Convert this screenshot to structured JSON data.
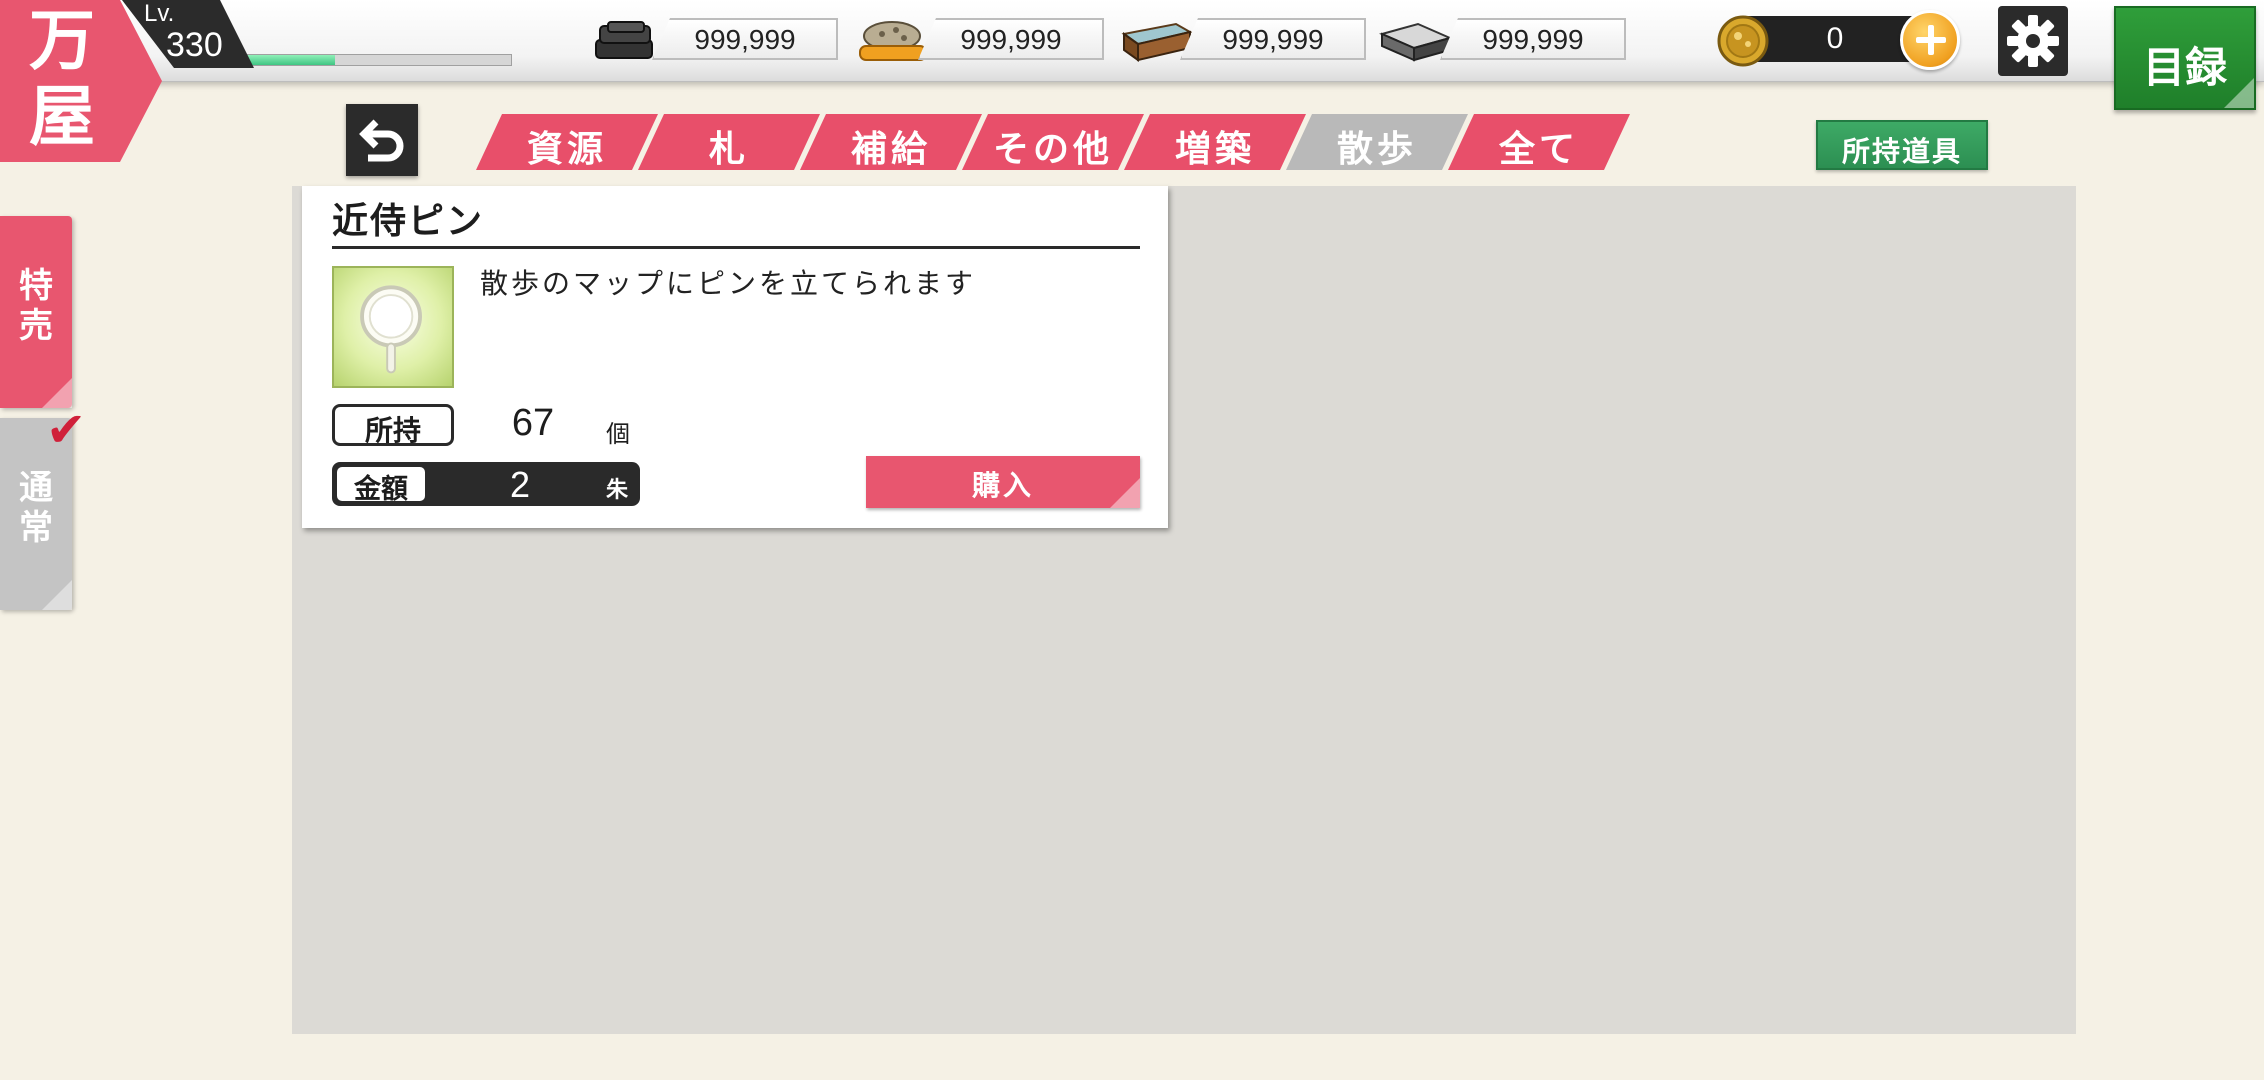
{
  "header": {
    "logo_text": "万屋",
    "level_label": "Lv.",
    "level_value": "330",
    "exp_progress": 0.34,
    "resources": [
      {
        "icon": "charcoal-icon",
        "value": "999,999"
      },
      {
        "icon": "whetstone-icon",
        "value": "999,999"
      },
      {
        "icon": "cooling-material-icon",
        "value": "999,999"
      },
      {
        "icon": "steel-ingot-icon",
        "value": "999,999"
      }
    ],
    "koban": {
      "icon": "koban-coin-icon",
      "value": "0"
    },
    "catalog_label": "目録"
  },
  "toolbar": {
    "tabs": [
      {
        "label": "資源",
        "active": true
      },
      {
        "label": "札",
        "active": true
      },
      {
        "label": "補給",
        "active": true
      },
      {
        "label": "その他",
        "active": true
      },
      {
        "label": "増築",
        "active": true
      },
      {
        "label": "散歩",
        "active": false
      },
      {
        "label": "全て",
        "active": true
      }
    ],
    "owned_items_label": "所持道具"
  },
  "side_tabs": {
    "sale_label": "特売",
    "normal_label": "通常",
    "selected": "normal"
  },
  "item": {
    "name": "近侍ピン",
    "description": "散歩のマップにピンを立てられます",
    "icon": "pin-icon",
    "owned_label": "所持",
    "owned_count": "67",
    "owned_unit": "個",
    "price_label": "金額",
    "price_value": "2",
    "price_unit": "朱",
    "buy_label": "購入"
  },
  "colors": {
    "accent_red": "#e84f6a",
    "inactive_gray": "#b9b9b9",
    "green_button": "#2c8f52",
    "background": "#f5f1e5",
    "panel": "#dcdad5"
  }
}
